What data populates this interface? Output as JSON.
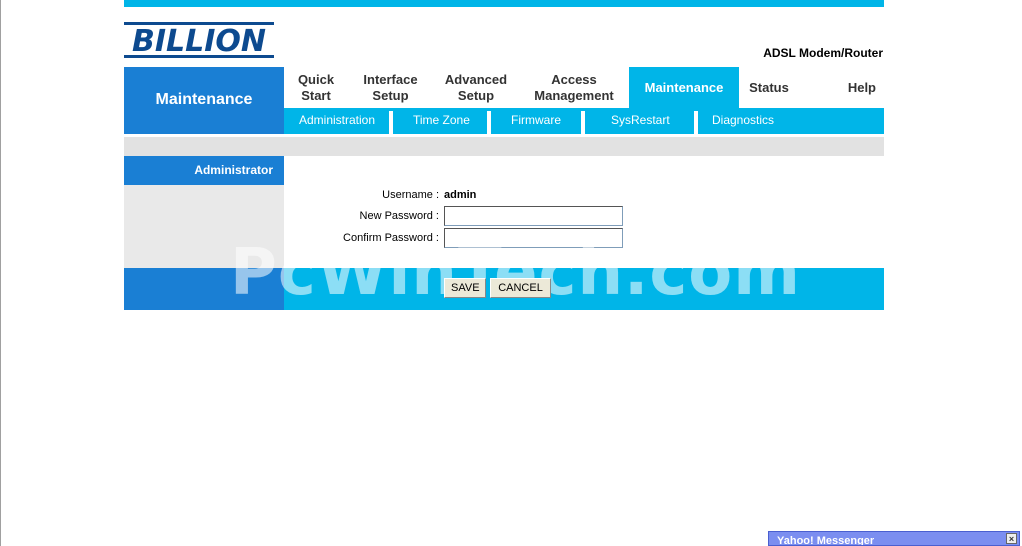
{
  "header": {
    "brand": "BILLION",
    "model": "ADSL Modem/Router"
  },
  "section_title": "Maintenance",
  "nav": {
    "items": [
      {
        "line1": "Quick",
        "line2": "Start"
      },
      {
        "line1": "Interface",
        "line2": "Setup"
      },
      {
        "line1": "Advanced",
        "line2": "Setup"
      },
      {
        "line1": "Access",
        "line2": "Management"
      },
      {
        "line1": "Maintenance",
        "line2": ""
      },
      {
        "line1": "Status",
        "line2": ""
      },
      {
        "line1": "Help",
        "line2": ""
      }
    ],
    "active_index": 4
  },
  "subnav": {
    "items": [
      "Administration",
      "Time Zone",
      "Firmware",
      "SysRestart",
      "Diagnostics"
    ]
  },
  "sidebar": {
    "heading": "Administrator"
  },
  "form": {
    "username_label": "Username :",
    "username_value": "admin",
    "new_password_label": "New Password :",
    "new_password_value": "",
    "confirm_password_label": "Confirm Password :",
    "confirm_password_value": ""
  },
  "buttons": {
    "save": "SAVE",
    "cancel": "CANCEL"
  },
  "watermark": "PcWinTech.com",
  "popup": {
    "title": "Yahoo! Messenger",
    "close_glyph": "×"
  },
  "colors": {
    "accent_blue": "#1a7fd4",
    "accent_cyan": "#00b5e8",
    "brand_navy": "#0d4a8f"
  }
}
